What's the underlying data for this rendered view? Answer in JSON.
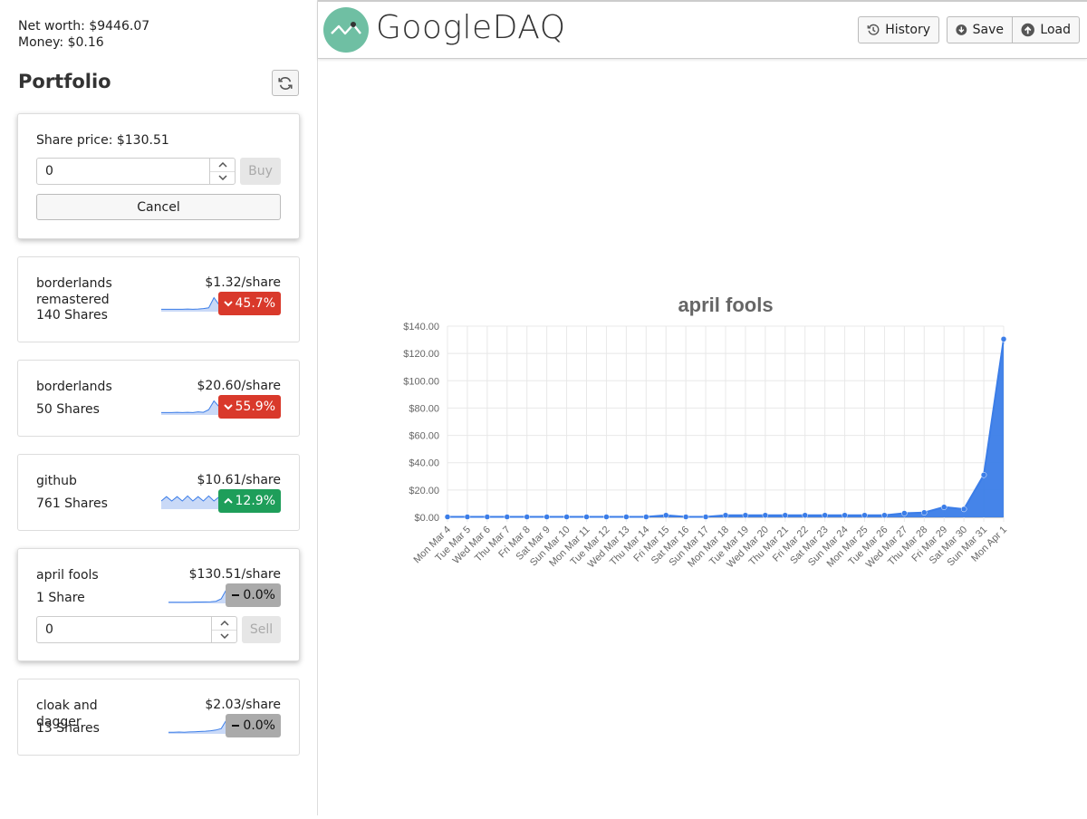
{
  "sidebar": {
    "net_worth": "Net worth: $9446.07",
    "money": "Money: $0.16",
    "portfolio_title": "Portfolio",
    "refresh_icon": "refresh-icon",
    "buy_panel": {
      "share_price": "Share price: $130.51",
      "quantity_value": "0",
      "buy_label": "Buy",
      "cancel_label": "Cancel"
    },
    "stocks": [
      {
        "name": "borderlands remastered",
        "shares": "140 Shares",
        "price": "$1.32/share",
        "change": "45.7%",
        "direction": "down",
        "spark": [
          0.1,
          0.1,
          0.1,
          0.1,
          0.1,
          0.12,
          0.1,
          0.12,
          0.15,
          0.2,
          0.9,
          0.4
        ],
        "color": "#d9392b"
      },
      {
        "name": "borderlands",
        "shares": "50 Shares",
        "price": "$20.60/share",
        "change": "55.9%",
        "direction": "down",
        "spark": [
          0.1,
          0.1,
          0.1,
          0.12,
          0.1,
          0.12,
          0.1,
          0.15,
          0.12,
          0.3,
          0.9,
          0.5
        ],
        "color": "#d9392b"
      },
      {
        "name": "github",
        "shares": "761 Shares",
        "price": "$10.61/share",
        "change": "12.9%",
        "direction": "up",
        "spark": [
          0.5,
          0.8,
          0.5,
          0.8,
          0.5,
          0.85,
          0.5,
          0.8,
          0.5,
          0.85,
          0.5,
          0.8
        ],
        "color": "#1e9e5a"
      },
      {
        "name": "april fools",
        "shares": "1 Share",
        "price": "$130.51/share",
        "change": "0.0%",
        "direction": "flat",
        "spark": [
          0.02,
          0.02,
          0.02,
          0.02,
          0.02,
          0.03,
          0.03,
          0.04,
          0.05,
          0.08,
          0.25,
          0.9
        ],
        "color": "#aaaaaa",
        "sell_value": "0",
        "sell_label": "Sell"
      },
      {
        "name": "cloak and dagger",
        "shares": "13 Shares",
        "price": "$2.03/share",
        "change": "0.0%",
        "direction": "flat",
        "spark": [
          0.05,
          0.05,
          0.06,
          0.05,
          0.07,
          0.08,
          0.1,
          0.12,
          0.15,
          0.2,
          0.3,
          0.9
        ],
        "color": "#aaaaaa"
      }
    ]
  },
  "header": {
    "app_title": "GoogleDAQ",
    "history_label": "History",
    "save_label": "Save",
    "load_label": "Load"
  },
  "chart_data": {
    "type": "area",
    "title": "april fools",
    "xlabel": "",
    "ylabel": "",
    "ylim": [
      0,
      140
    ],
    "yticks": [
      "$0.00",
      "$20.00",
      "$40.00",
      "$60.00",
      "$80.00",
      "$100.00",
      "$120.00",
      "$140.00"
    ],
    "grid": true,
    "color": "#3b7de8",
    "categories": [
      "Mon Mar 4",
      "Tue Mar 5",
      "Wed Mar 6",
      "Thu Mar 7",
      "Fri Mar 8",
      "Sat Mar 9",
      "Sun Mar 10",
      "Mon Mar 11",
      "Tue Mar 12",
      "Wed Mar 13",
      "Thu Mar 14",
      "Fri Mar 15",
      "Sat Mar 16",
      "Sun Mar 17",
      "Mon Mar 18",
      "Tue Mar 19",
      "Wed Mar 20",
      "Thu Mar 21",
      "Fri Mar 22",
      "Sat Mar 23",
      "Sun Mar 24",
      "Mon Mar 25",
      "Tue Mar 26",
      "Wed Mar 27",
      "Thu Mar 28",
      "Fri Mar 29",
      "Sat Mar 30",
      "Sun Mar 31",
      "Mon Apr 1"
    ],
    "values": [
      0.3,
      0.3,
      0.3,
      0.3,
      0.3,
      0.3,
      0.3,
      0.3,
      0.3,
      0.3,
      0.3,
      1.5,
      0.3,
      0.3,
      1.5,
      1.5,
      1.5,
      1.5,
      1.5,
      1.5,
      1.5,
      1.5,
      1.5,
      3,
      3.5,
      7.5,
      6,
      31,
      130.51
    ]
  }
}
